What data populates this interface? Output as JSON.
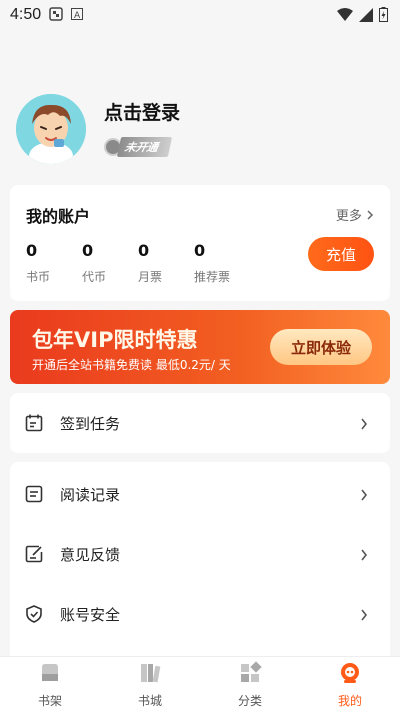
{
  "status_bar": {
    "time": "4:50"
  },
  "profile": {
    "login_label": "点击登录",
    "vip_status": "未开通"
  },
  "account": {
    "title": "我的账户",
    "more_label": "更多",
    "stats": [
      {
        "value": "0",
        "label": "书币"
      },
      {
        "value": "0",
        "label": "代币"
      },
      {
        "value": "0",
        "label": "月票"
      },
      {
        "value": "0",
        "label": "推荐票"
      }
    ],
    "recharge_label": "充值"
  },
  "promo": {
    "headline": "包年VIP限时特惠",
    "subtitle": "开通后全站书籍免费读 最低0.2元/ 天",
    "cta_label": "立即体验"
  },
  "menu_top": [
    {
      "label": "签到任务",
      "icon": "calendar-icon"
    }
  ],
  "menu_main": [
    {
      "label": "阅读记录",
      "icon": "history-icon"
    },
    {
      "label": "意见反馈",
      "icon": "feedback-icon"
    },
    {
      "label": "账号安全",
      "icon": "shield-icon"
    }
  ],
  "tabs": [
    {
      "label": "书架",
      "icon": "bookshelf-icon"
    },
    {
      "label": "书城",
      "icon": "bookstore-icon"
    },
    {
      "label": "分类",
      "icon": "category-icon"
    },
    {
      "label": "我的",
      "icon": "profile-icon",
      "active": true
    }
  ],
  "colors": {
    "accent": "#ff5a17",
    "tab_inactive": "#bdbdbd"
  }
}
